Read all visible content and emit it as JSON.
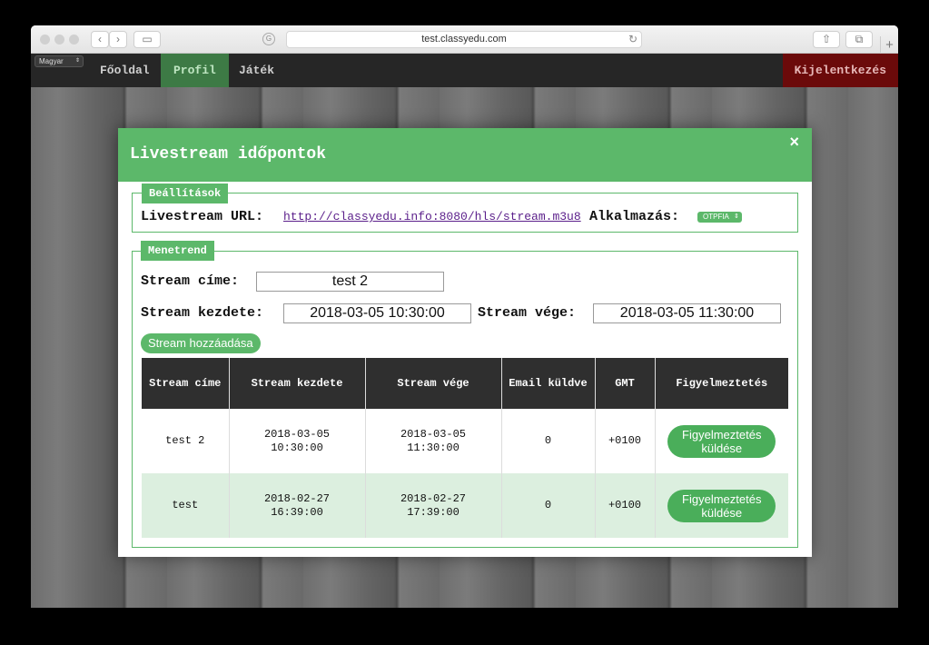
{
  "browser": {
    "url": "test.classyedu.com"
  },
  "nav": {
    "language": "Magyar",
    "items": [
      {
        "label": "Főoldal"
      },
      {
        "label": "Profil"
      },
      {
        "label": "Játék"
      }
    ],
    "logout_label": "Kijelentkezés"
  },
  "modal": {
    "title": "Livestream időpontok",
    "close_symbol": "×",
    "settings": {
      "legend": "Beállítások",
      "url_label": "Livestream URL:",
      "url_value": "http://classyedu.info:8080/hls/stream.m3u8",
      "app_label": "Alkalmazás:",
      "app_value": "OTPFIA"
    },
    "schedule": {
      "legend": "Menetrend",
      "title_label": "Stream címe:",
      "title_value": "test 2",
      "start_label": "Stream kezdete:",
      "start_value": "2018-03-05 10:30:00",
      "end_label": "Stream vége:",
      "end_value": "2018-03-05 11:30:00",
      "add_button": "Stream hozzáadása"
    },
    "table": {
      "headers": [
        "Stream címe",
        "Stream kezdete",
        "Stream vége",
        "Email küldve",
        "GMT",
        "Figyelmeztetés"
      ],
      "rows": [
        {
          "title": "test 2",
          "start_date": "2018-03-05",
          "start_time": "10:30:00",
          "end_date": "2018-03-05",
          "end_time": "11:30:00",
          "email": "0",
          "gmt": "+0100",
          "button": "Figyelmeztetés küldése"
        },
        {
          "title": "test",
          "start_date": "2018-02-27",
          "start_time": "16:39:00",
          "end_date": "2018-02-27",
          "end_time": "17:39:00",
          "email": "0",
          "gmt": "+0100",
          "button": "Figyelmeztetés küldése"
        }
      ]
    }
  },
  "colors": {
    "accent_green": "#5cb86a",
    "logout_red": "#6b0a0a",
    "navbar": "#262626"
  }
}
